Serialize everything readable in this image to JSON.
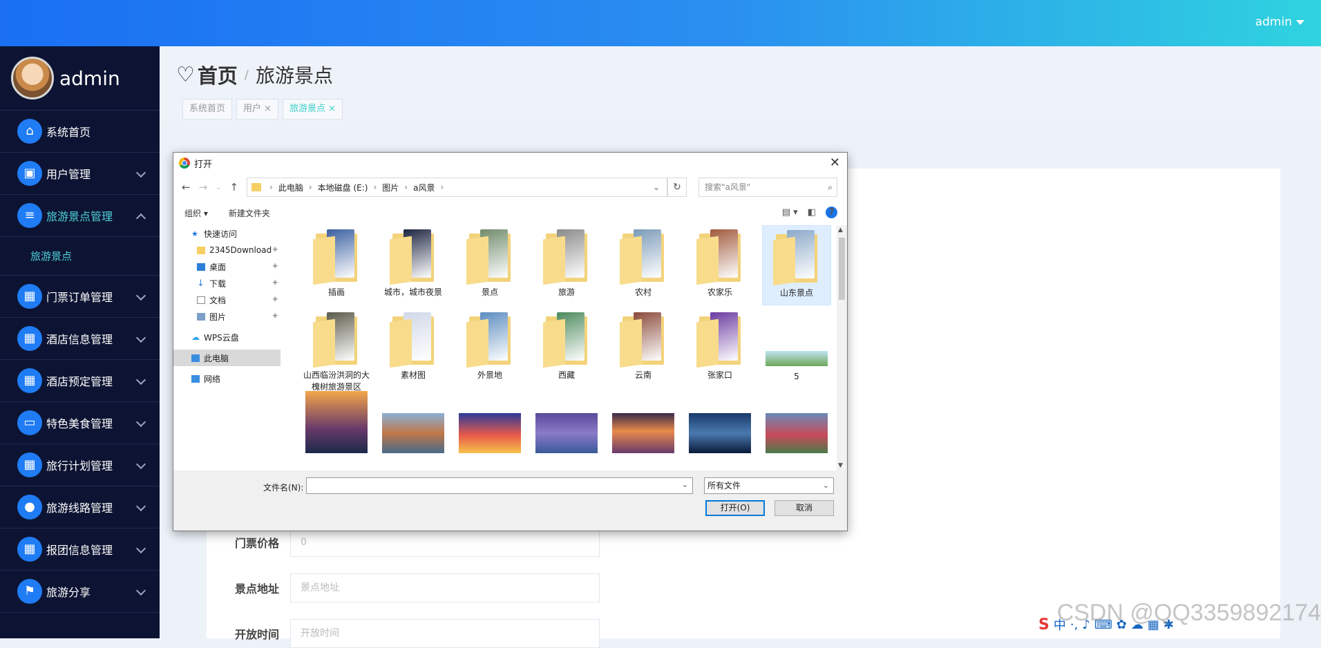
{
  "topbar": {
    "user": "admin"
  },
  "sidebar": {
    "profile_name": "admin",
    "items": [
      {
        "label": "系统首页",
        "icon": "home-icon",
        "glyph": "⌂"
      },
      {
        "label": "用户管理",
        "icon": "briefcase-icon",
        "glyph": "▣"
      },
      {
        "label": "旅游景点管理",
        "icon": "sliders-icon",
        "glyph": "≡"
      },
      {
        "label": "门票订单管理",
        "icon": "grid-icon",
        "glyph": "▦"
      },
      {
        "label": "酒店信息管理",
        "icon": "grid-icon",
        "glyph": "▦"
      },
      {
        "label": "酒店预定管理",
        "icon": "grid-icon",
        "glyph": "▦"
      },
      {
        "label": "特色美食管理",
        "icon": "monitor-icon",
        "glyph": "▭"
      },
      {
        "label": "旅行计划管理",
        "icon": "grid-icon",
        "glyph": "▦"
      },
      {
        "label": "旅游线路管理",
        "icon": "user-icon",
        "glyph": "●"
      },
      {
        "label": "报团信息管理",
        "icon": "grid-icon",
        "glyph": "▦"
      },
      {
        "label": "旅游分享",
        "icon": "flag-icon",
        "glyph": "⚑"
      }
    ],
    "submenu": "旅游景点"
  },
  "header": {
    "home": "首页",
    "separator": "/",
    "current": "旅游景点",
    "tabs": [
      {
        "label": "系统首页",
        "closable": false
      },
      {
        "label": "用户",
        "closable": true
      },
      {
        "label": "旅游景点",
        "closable": true
      }
    ]
  },
  "form": {
    "rows": [
      {
        "label": "门票价格",
        "placeholder": "0"
      },
      {
        "label": "景点地址",
        "placeholder": "景点地址"
      },
      {
        "label": "开放时间",
        "placeholder": "开放时间"
      }
    ]
  },
  "dialog": {
    "title": "打开",
    "path": [
      "此电脑",
      "本地磁盘 (E:)",
      "图片",
      "a风景"
    ],
    "search_placeholder": "搜索\"a风景\"",
    "toolbar": {
      "organize": "组织 ▾",
      "new_folder": "新建文件夹"
    },
    "nav": [
      {
        "label": "快速访问",
        "icon": "star-icon"
      },
      {
        "label": "2345Download",
        "icon": "folder-icon"
      },
      {
        "label": "桌面",
        "icon": "desktop-icon"
      },
      {
        "label": "下载",
        "icon": "download-icon"
      },
      {
        "label": "文档",
        "icon": "document-icon"
      },
      {
        "label": "图片",
        "icon": "pictures-icon"
      },
      {
        "label": "WPS云盘",
        "icon": "cloud-icon"
      },
      {
        "label": "此电脑",
        "icon": "computer-icon"
      },
      {
        "label": "网络",
        "icon": "network-icon"
      }
    ],
    "folders": [
      {
        "label": "插画",
        "color": "#3a5fa0"
      },
      {
        "label": "城市，城市夜景",
        "color": "#1b2340"
      },
      {
        "label": "景点",
        "color": "#6f8a6a"
      },
      {
        "label": "旅游",
        "color": "#8a8a8a"
      },
      {
        "label": "农村",
        "color": "#7a9ab8"
      },
      {
        "label": "农家乐",
        "color": "#a0593c"
      },
      {
        "label": "山东景点",
        "color": "#8aa8c8"
      },
      {
        "label": "山西临汾洪洞的大槐树旅游景区",
        "color": "#5a5a4a"
      },
      {
        "label": "素材图",
        "color": "#d0d8e8"
      },
      {
        "label": "外景地",
        "color": "#5c8cc0"
      },
      {
        "label": "西藏",
        "color": "#4d8a5c"
      },
      {
        "label": "云南",
        "color": "#8a4a3a"
      },
      {
        "label": "张家口",
        "color": "#6a3aa0"
      },
      {
        "label": "5",
        "color": "#7fb0c8"
      }
    ],
    "filename_label": "文件名(N):",
    "filetype": "所有文件",
    "open_button": "打开(O)",
    "cancel_button": "取消"
  },
  "watermark": "CSDN @QQ3359892174"
}
